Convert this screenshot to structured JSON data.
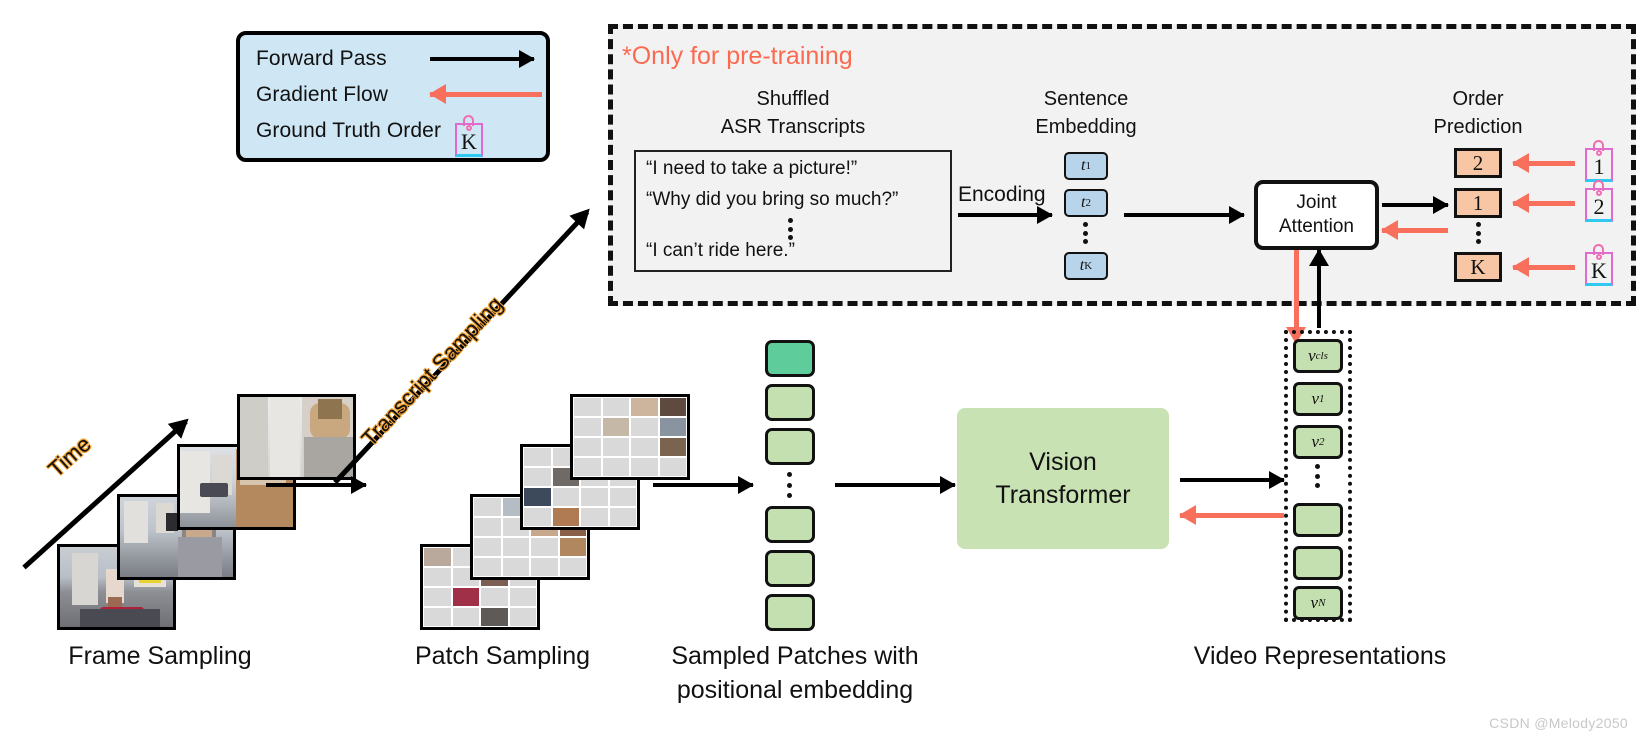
{
  "legend": {
    "items": [
      {
        "label": "Forward Pass",
        "marker": "black-arrow-right"
      },
      {
        "label": "Gradient Flow",
        "marker": "red-arrow-left"
      },
      {
        "label": "Ground Truth Order",
        "marker": "tag-icon",
        "tag_text": "K"
      }
    ]
  },
  "pretrain": {
    "note": "*Only for pre-training",
    "note_color": "#fb6a4f",
    "transcripts": {
      "heading_line1": "Shuffled",
      "heading_line2": "ASR Transcripts",
      "lines": [
        "“I need to take a picture!”",
        "“Why did you bring so much?”",
        "“I can’t ride here.”"
      ],
      "ellipsis": "⋮"
    },
    "encoding_label": "Encoding",
    "embedding": {
      "heading_line1": "Sentence",
      "heading_line2": "Embedding",
      "tokens": [
        "t1",
        "t2",
        "tK"
      ],
      "token_base": "t",
      "token_subs": [
        "1",
        "2",
        "K"
      ]
    },
    "joint_attention": {
      "line1": "Joint",
      "line2": "Attention"
    },
    "order_prediction": {
      "heading_line1": "Order",
      "heading_line2": "Prediction",
      "predictions": [
        "2",
        "1",
        "K"
      ],
      "ground_truth_tags": [
        "1",
        "2",
        "K"
      ]
    }
  },
  "pipeline": {
    "time_label": "Time",
    "transcript_sampling_label": "Transcript Sampling",
    "vision_transformer": {
      "line1": "Vision",
      "line2": "Transformer"
    },
    "captions": {
      "frame_sampling": "Frame Sampling",
      "patch_sampling": "Patch Sampling",
      "sampled_patches_line1": "Sampled Patches with",
      "sampled_patches_line2": "positional embedding",
      "video_representations": "Video Representations"
    },
    "video_tokens": [
      "vcls",
      "v1",
      "v2",
      "",
      "",
      "vN"
    ],
    "video_token_labels": [
      {
        "base": "v",
        "sub": "cls"
      },
      {
        "base": "v",
        "sub": "1"
      },
      {
        "base": "v",
        "sub": "2"
      },
      {
        "base": "",
        "sub": ""
      },
      {
        "base": "",
        "sub": ""
      },
      {
        "base": "v",
        "sub": "N"
      }
    ]
  },
  "watermark": "CSDN @Melody2050",
  "colors": {
    "legend_bg": "#cfe7f5",
    "accent_red": "#f8705c",
    "patch_green": "#c5e0b0",
    "cls_green": "#5fcc9c",
    "token_blue": "#b8d4ea",
    "order_orange": "#f7c6a4",
    "panel_gray": "#f2f2f2"
  }
}
